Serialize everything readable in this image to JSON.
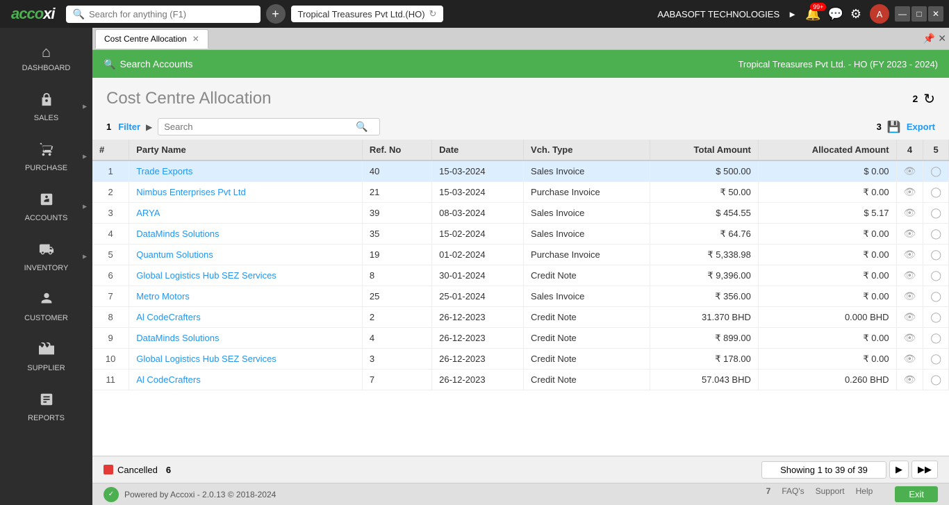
{
  "app": {
    "logo": "accoxi",
    "search_placeholder": "Search for anything (F1)",
    "company": "Tropical Treasures Pvt Ltd.(HO)",
    "org_name": "AABASOFT TECHNOLOGIES",
    "notif_badge": "99+"
  },
  "tabs": [
    {
      "label": "Cost Centre Allocation",
      "active": true
    }
  ],
  "green_header": {
    "search_label": "Search Accounts",
    "company_label": "Tropical Treasures Pvt Ltd. - HO (FY 2023 - 2024)"
  },
  "page": {
    "title": "Cost Centre Allocation",
    "filter_label": "Filter",
    "search_placeholder": "Search",
    "export_label": "Export"
  },
  "labels": {
    "num1": "1",
    "num2": "2",
    "num3": "3",
    "num4": "4",
    "num5": "5",
    "num6": "6",
    "num7": "7"
  },
  "table": {
    "columns": [
      "#",
      "Party Name",
      "Ref. No",
      "Date",
      "Vch. Type",
      "Total Amount",
      "Allocated Amount",
      "",
      ""
    ],
    "rows": [
      {
        "num": "1",
        "party": "Trade Exports",
        "ref": "40",
        "date": "15-03-2024",
        "vch": "Sales Invoice",
        "total": "$ 500.00",
        "allocated": "$ 0.00",
        "selected": true
      },
      {
        "num": "2",
        "party": "Nimbus Enterprises Pvt Ltd",
        "ref": "21",
        "date": "15-03-2024",
        "vch": "Purchase Invoice",
        "total": "₹ 50.00",
        "allocated": "₹ 0.00",
        "selected": false
      },
      {
        "num": "3",
        "party": "ARYA",
        "ref": "39",
        "date": "08-03-2024",
        "vch": "Sales Invoice",
        "total": "$ 454.55",
        "allocated": "$ 5.17",
        "selected": false
      },
      {
        "num": "4",
        "party": "DataMinds Solutions",
        "ref": "35",
        "date": "15-02-2024",
        "vch": "Sales Invoice",
        "total": "₹ 64.76",
        "allocated": "₹ 0.00",
        "selected": false
      },
      {
        "num": "5",
        "party": "Quantum Solutions",
        "ref": "19",
        "date": "01-02-2024",
        "vch": "Purchase Invoice",
        "total": "₹ 5,338.98",
        "allocated": "₹ 0.00",
        "selected": false
      },
      {
        "num": "6",
        "party": "Global Logistics Hub SEZ Services",
        "ref": "8",
        "date": "30-01-2024",
        "vch": "Credit Note",
        "total": "₹ 9,396.00",
        "allocated": "₹ 0.00",
        "selected": false
      },
      {
        "num": "7",
        "party": "Metro Motors",
        "ref": "25",
        "date": "25-01-2024",
        "vch": "Sales Invoice",
        "total": "₹ 356.00",
        "allocated": "₹ 0.00",
        "selected": false
      },
      {
        "num": "8",
        "party": "Al CodeCrafters",
        "ref": "2",
        "date": "26-12-2023",
        "vch": "Credit Note",
        "total": "31.370 BHD",
        "allocated": "0.000 BHD",
        "selected": false
      },
      {
        "num": "9",
        "party": "DataMinds Solutions",
        "ref": "4",
        "date": "26-12-2023",
        "vch": "Credit Note",
        "total": "₹ 899.00",
        "allocated": "₹ 0.00",
        "selected": false
      },
      {
        "num": "10",
        "party": "Global Logistics Hub SEZ Services",
        "ref": "3",
        "date": "26-12-2023",
        "vch": "Credit Note",
        "total": "₹ 178.00",
        "allocated": "₹ 0.00",
        "selected": false
      },
      {
        "num": "11",
        "party": "Al CodeCrafters",
        "ref": "7",
        "date": "26-12-2023",
        "vch": "Credit Note",
        "total": "57.043 BHD",
        "allocated": "0.260 BHD",
        "selected": false
      }
    ]
  },
  "sidebar": {
    "items": [
      {
        "id": "dashboard",
        "label": "DASHBOARD",
        "icon": "⌂"
      },
      {
        "id": "sales",
        "label": "SALES",
        "icon": "🏷",
        "has_arrow": true
      },
      {
        "id": "purchase",
        "label": "PURCHASE",
        "icon": "🛒",
        "has_arrow": true
      },
      {
        "id": "accounts",
        "label": "ACCOUNTS",
        "icon": "🧮",
        "has_arrow": true
      },
      {
        "id": "inventory",
        "label": "INVENTORY",
        "icon": "📦",
        "has_arrow": true
      },
      {
        "id": "customer",
        "label": "CUSTOMER",
        "icon": "👤"
      },
      {
        "id": "supplier",
        "label": "SUPPLIER",
        "icon": "💼"
      },
      {
        "id": "reports",
        "label": "REPORTS",
        "icon": "📊"
      }
    ]
  },
  "status": {
    "cancelled_label": "Cancelled",
    "pagination_info": "Showing 1 to 39 of 39",
    "footer_text": "Powered by Accoxi - 2.0.13 © 2018-2024",
    "faq": "FAQ's",
    "support": "Support",
    "help": "Help",
    "exit": "Exit"
  }
}
